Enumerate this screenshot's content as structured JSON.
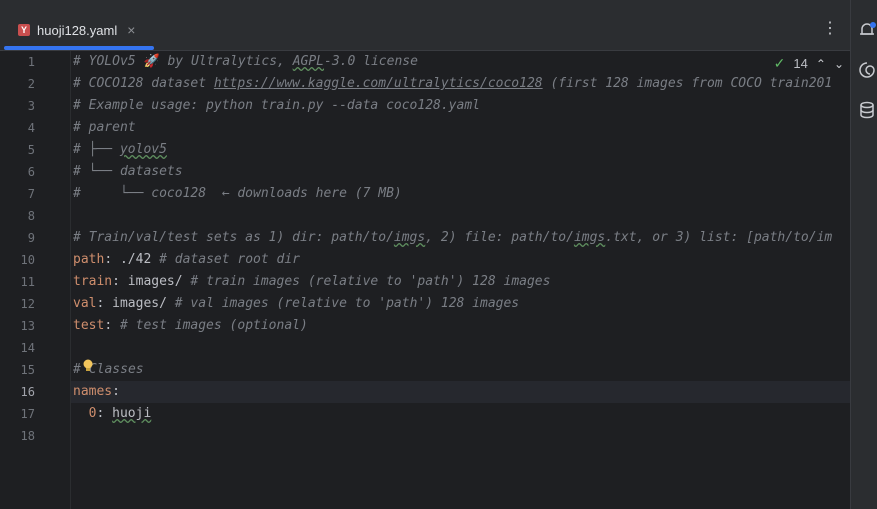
{
  "tab": {
    "icon_letter": "Y",
    "title": "huoji128.yaml",
    "close": "×",
    "menu": "⋮"
  },
  "inspections": {
    "count": "14",
    "up": "⌃",
    "down": "⌄"
  },
  "line_numbers": [
    "1",
    "2",
    "3",
    "4",
    "5",
    "6",
    "7",
    "8",
    "9",
    "10",
    "11",
    "12",
    "13",
    "14",
    "15",
    "16",
    "17",
    "18"
  ],
  "current_line": "16",
  "code": {
    "l1a": "# YOLOv5 ",
    "l1rocket": "🚀",
    "l1b": " by Ultralytics, ",
    "l1c": "AGPL",
    "l1d": "-3.0 license",
    "l2a": "# COCO128 dataset ",
    "l2link": "https://www.kaggle.com/ultralytics/coco128",
    "l2b": " (first 128 images from COCO train201",
    "l3": "# Example usage: python train.py --data coco128.yaml",
    "l4": "# parent",
    "l5a": "# ├── ",
    "l5b": "yolov5",
    "l6": "# └── datasets",
    "l7": "#     └── coco128  ← downloads here (7 MB)",
    "l9a": "# Train/val/test sets as 1) dir: path/to/",
    "l9b": "imgs",
    "l9c": ", 2) file: path/to/",
    "l9d": "imgs",
    "l9e": ".txt, or 3) list: [path/to/im",
    "l10k": "path",
    "l10v": ": ./42 ",
    "l10c": "# dataset root dir",
    "l11k": "train",
    "l11v": ": images/ ",
    "l11c": "# train images (relative to 'path') 128 images",
    "l12k": "val",
    "l12v": ": images/ ",
    "l12c": "# val images (relative to 'path') 128 images",
    "l13k": "test",
    "l13v": ": ",
    "l13c": "# test images (optional)",
    "l15a": "#",
    "l15b": "Classes",
    "l16k": "names",
    "l16v": ":",
    "l17k": "  0",
    "l17v": ": ",
    "l17w": "huoji"
  },
  "colors": {
    "accent": "#3574f0",
    "keyword": "#cf8e6d",
    "comment": "#7a7e85",
    "check": "#5fb865"
  },
  "icons": [
    "yaml-file-icon",
    "close-icon",
    "more-options-icon",
    "check-icon",
    "chevron-up-icon",
    "chevron-down-icon",
    "lightbulb-icon",
    "notifications-icon",
    "ai-assistant-icon",
    "database-icon"
  ]
}
